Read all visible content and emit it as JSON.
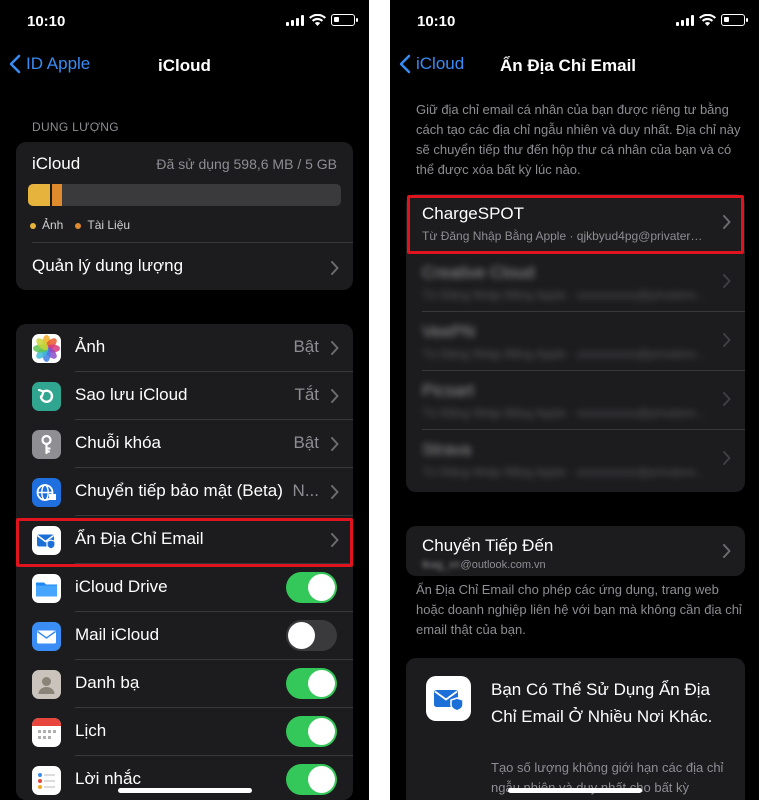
{
  "left": {
    "status": {
      "time": "10:10"
    },
    "nav": {
      "back": "ID Apple",
      "title": "iCloud"
    },
    "storage": {
      "section": "DUNG LƯỢNG",
      "title": "iCloud",
      "used": "Đã sử dụng 598,6 MB / 5 GB",
      "segments": [
        {
          "name": "Ảnh",
          "fraction": 0.07,
          "color": "#e6b43c"
        },
        {
          "name": "Tài Liệu",
          "fraction": 0.04,
          "color": "#e08a2e"
        }
      ],
      "legend": [
        "Ảnh",
        "Tài Liệu"
      ],
      "manage": "Quản lý dung lượng"
    },
    "apps": [
      {
        "label": "Ảnh",
        "value": "Bật",
        "icon": "photos-icon"
      },
      {
        "label": "Sao lưu iCloud",
        "value": "Tắt",
        "icon": "backup-icon"
      },
      {
        "label": "Chuỗi khóa",
        "value": "Bật",
        "icon": "keychain-icon"
      },
      {
        "label": "Chuyển tiếp bảo mật (Beta)",
        "value": "N...",
        "icon": "private-relay-icon"
      },
      {
        "label": "Ẩn Địa Chỉ Email",
        "value": "",
        "icon": "hide-email-icon"
      },
      {
        "label": "iCloud Drive",
        "toggle": true,
        "icon": "folder-icon"
      },
      {
        "label": "Mail iCloud",
        "toggle": false,
        "icon": "mail-icon"
      },
      {
        "label": "Danh bạ",
        "toggle": true,
        "icon": "contacts-icon"
      },
      {
        "label": "Lịch",
        "toggle": true,
        "icon": "calendar-icon"
      },
      {
        "label": "Lời nhắc",
        "toggle": true,
        "icon": "reminders-icon"
      }
    ]
  },
  "right": {
    "status": {
      "time": "10:10"
    },
    "nav": {
      "back": "iCloud",
      "title": "Ẩn Địa Chỉ Email"
    },
    "intro": "Giữ địa chỉ email cá nhân của bạn được riêng tư bằng cách tạo các địa chỉ ngẫu nhiên và duy nhất. Địa chỉ này sẽ chuyển tiếp thư đến hộp thư cá nhân của bạn và có thể được xóa bất kỳ lúc nào.",
    "addresses": [
      {
        "title": "ChargeSPOT",
        "subtitle": "Từ Đăng Nhập Bằng Apple · qjkbyud4pg@privaterelay.appleid.com"
      },
      {
        "title": "Creative Cloud",
        "subtitle": "Từ Đăng Nhập Bằng Apple · xxxxxxxxxx@privaterelay.appleid.com"
      },
      {
        "title": "VeePN",
        "subtitle": "Từ Đăng Nhập Bằng Apple · xxxxxxxxxx@privaterelay.appleid.com"
      },
      {
        "title": "Picsart",
        "subtitle": "Từ Đăng Nhập Bằng Apple · xxxxxxxxxx@privaterelay.appleid.com"
      },
      {
        "title": "Strava",
        "subtitle": "Từ Đăng Nhập Bằng Apple · xxxxxxxxxx@privaterelay.appleid.com"
      }
    ],
    "forward": {
      "title": "Chuyển Tiếp Đến",
      "masked": "tkag_vn",
      "domain": "@outlook.com.vn"
    },
    "footer": "Ẩn Địa Chỉ Email cho phép các ứng dụng, trang web hoặc doanh nghiệp liên hệ với bạn mà không cần địa chỉ email thật của bạn.",
    "promo": {
      "title": "Bạn Có Thể Sử Dụng Ẩn Địa Chỉ Email Ở Nhiều Nơi Khác.",
      "body": "Tạo số lượng không giới hạn các địa chỉ ngẫu nhiên và duy nhất cho bất kỳ"
    }
  },
  "colors": {
    "accent": "#3a8cf5",
    "toggle_on": "#34c759",
    "highlight": "#e0141e"
  }
}
